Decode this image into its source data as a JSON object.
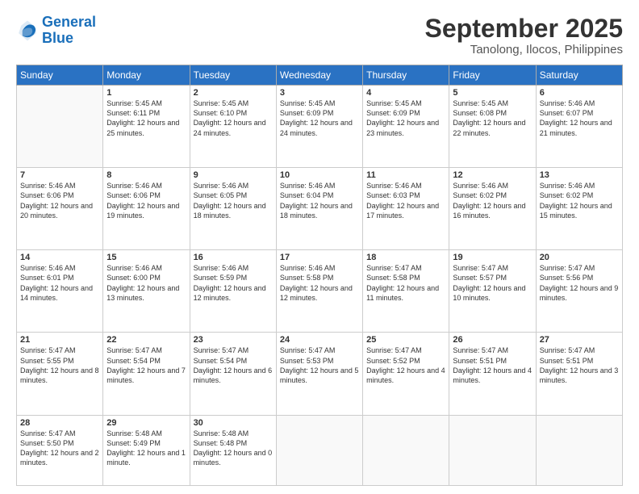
{
  "header": {
    "logo_line1": "General",
    "logo_line2": "Blue",
    "month": "September 2025",
    "location": "Tanolong, Ilocos, Philippines"
  },
  "weekdays": [
    "Sunday",
    "Monday",
    "Tuesday",
    "Wednesday",
    "Thursday",
    "Friday",
    "Saturday"
  ],
  "weeks": [
    [
      {
        "day": "",
        "sunrise": "",
        "sunset": "",
        "daylight": ""
      },
      {
        "day": "1",
        "sunrise": "Sunrise: 5:45 AM",
        "sunset": "Sunset: 6:11 PM",
        "daylight": "Daylight: 12 hours and 25 minutes."
      },
      {
        "day": "2",
        "sunrise": "Sunrise: 5:45 AM",
        "sunset": "Sunset: 6:10 PM",
        "daylight": "Daylight: 12 hours and 24 minutes."
      },
      {
        "day": "3",
        "sunrise": "Sunrise: 5:45 AM",
        "sunset": "Sunset: 6:09 PM",
        "daylight": "Daylight: 12 hours and 24 minutes."
      },
      {
        "day": "4",
        "sunrise": "Sunrise: 5:45 AM",
        "sunset": "Sunset: 6:09 PM",
        "daylight": "Daylight: 12 hours and 23 minutes."
      },
      {
        "day": "5",
        "sunrise": "Sunrise: 5:45 AM",
        "sunset": "Sunset: 6:08 PM",
        "daylight": "Daylight: 12 hours and 22 minutes."
      },
      {
        "day": "6",
        "sunrise": "Sunrise: 5:46 AM",
        "sunset": "Sunset: 6:07 PM",
        "daylight": "Daylight: 12 hours and 21 minutes."
      }
    ],
    [
      {
        "day": "7",
        "sunrise": "Sunrise: 5:46 AM",
        "sunset": "Sunset: 6:06 PM",
        "daylight": "Daylight: 12 hours and 20 minutes."
      },
      {
        "day": "8",
        "sunrise": "Sunrise: 5:46 AM",
        "sunset": "Sunset: 6:06 PM",
        "daylight": "Daylight: 12 hours and 19 minutes."
      },
      {
        "day": "9",
        "sunrise": "Sunrise: 5:46 AM",
        "sunset": "Sunset: 6:05 PM",
        "daylight": "Daylight: 12 hours and 18 minutes."
      },
      {
        "day": "10",
        "sunrise": "Sunrise: 5:46 AM",
        "sunset": "Sunset: 6:04 PM",
        "daylight": "Daylight: 12 hours and 18 minutes."
      },
      {
        "day": "11",
        "sunrise": "Sunrise: 5:46 AM",
        "sunset": "Sunset: 6:03 PM",
        "daylight": "Daylight: 12 hours and 17 minutes."
      },
      {
        "day": "12",
        "sunrise": "Sunrise: 5:46 AM",
        "sunset": "Sunset: 6:02 PM",
        "daylight": "Daylight: 12 hours and 16 minutes."
      },
      {
        "day": "13",
        "sunrise": "Sunrise: 5:46 AM",
        "sunset": "Sunset: 6:02 PM",
        "daylight": "Daylight: 12 hours and 15 minutes."
      }
    ],
    [
      {
        "day": "14",
        "sunrise": "Sunrise: 5:46 AM",
        "sunset": "Sunset: 6:01 PM",
        "daylight": "Daylight: 12 hours and 14 minutes."
      },
      {
        "day": "15",
        "sunrise": "Sunrise: 5:46 AM",
        "sunset": "Sunset: 6:00 PM",
        "daylight": "Daylight: 12 hours and 13 minutes."
      },
      {
        "day": "16",
        "sunrise": "Sunrise: 5:46 AM",
        "sunset": "Sunset: 5:59 PM",
        "daylight": "Daylight: 12 hours and 12 minutes."
      },
      {
        "day": "17",
        "sunrise": "Sunrise: 5:46 AM",
        "sunset": "Sunset: 5:58 PM",
        "daylight": "Daylight: 12 hours and 12 minutes."
      },
      {
        "day": "18",
        "sunrise": "Sunrise: 5:47 AM",
        "sunset": "Sunset: 5:58 PM",
        "daylight": "Daylight: 12 hours and 11 minutes."
      },
      {
        "day": "19",
        "sunrise": "Sunrise: 5:47 AM",
        "sunset": "Sunset: 5:57 PM",
        "daylight": "Daylight: 12 hours and 10 minutes."
      },
      {
        "day": "20",
        "sunrise": "Sunrise: 5:47 AM",
        "sunset": "Sunset: 5:56 PM",
        "daylight": "Daylight: 12 hours and 9 minutes."
      }
    ],
    [
      {
        "day": "21",
        "sunrise": "Sunrise: 5:47 AM",
        "sunset": "Sunset: 5:55 PM",
        "daylight": "Daylight: 12 hours and 8 minutes."
      },
      {
        "day": "22",
        "sunrise": "Sunrise: 5:47 AM",
        "sunset": "Sunset: 5:54 PM",
        "daylight": "Daylight: 12 hours and 7 minutes."
      },
      {
        "day": "23",
        "sunrise": "Sunrise: 5:47 AM",
        "sunset": "Sunset: 5:54 PM",
        "daylight": "Daylight: 12 hours and 6 minutes."
      },
      {
        "day": "24",
        "sunrise": "Sunrise: 5:47 AM",
        "sunset": "Sunset: 5:53 PM",
        "daylight": "Daylight: 12 hours and 5 minutes."
      },
      {
        "day": "25",
        "sunrise": "Sunrise: 5:47 AM",
        "sunset": "Sunset: 5:52 PM",
        "daylight": "Daylight: 12 hours and 4 minutes."
      },
      {
        "day": "26",
        "sunrise": "Sunrise: 5:47 AM",
        "sunset": "Sunset: 5:51 PM",
        "daylight": "Daylight: 12 hours and 4 minutes."
      },
      {
        "day": "27",
        "sunrise": "Sunrise: 5:47 AM",
        "sunset": "Sunset: 5:51 PM",
        "daylight": "Daylight: 12 hours and 3 minutes."
      }
    ],
    [
      {
        "day": "28",
        "sunrise": "Sunrise: 5:47 AM",
        "sunset": "Sunset: 5:50 PM",
        "daylight": "Daylight: 12 hours and 2 minutes."
      },
      {
        "day": "29",
        "sunrise": "Sunrise: 5:48 AM",
        "sunset": "Sunset: 5:49 PM",
        "daylight": "Daylight: 12 hours and 1 minute."
      },
      {
        "day": "30",
        "sunrise": "Sunrise: 5:48 AM",
        "sunset": "Sunset: 5:48 PM",
        "daylight": "Daylight: 12 hours and 0 minutes."
      },
      {
        "day": "",
        "sunrise": "",
        "sunset": "",
        "daylight": ""
      },
      {
        "day": "",
        "sunrise": "",
        "sunset": "",
        "daylight": ""
      },
      {
        "day": "",
        "sunrise": "",
        "sunset": "",
        "daylight": ""
      },
      {
        "day": "",
        "sunrise": "",
        "sunset": "",
        "daylight": ""
      }
    ]
  ]
}
